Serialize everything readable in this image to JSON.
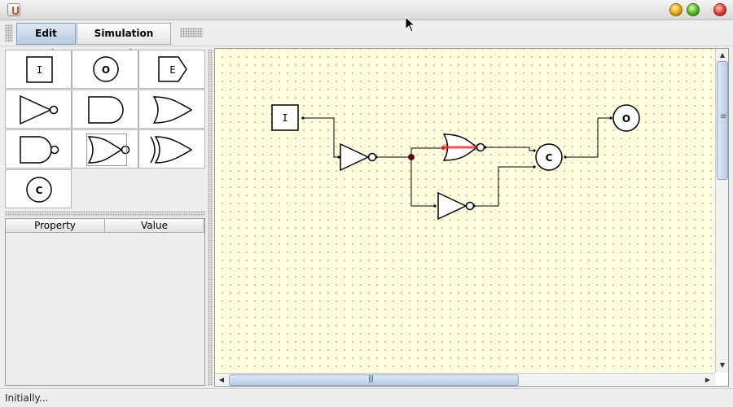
{
  "window": {
    "controls": [
      "minimize",
      "maximize",
      "close"
    ]
  },
  "toolbar": {
    "edit_mode_label": "Edit Mode",
    "simulation_mode_label": "Simulation Mode",
    "active_mode": "Edit Mode"
  },
  "palette": {
    "items": [
      {
        "name": "input",
        "label": "I",
        "icon": "input-box-icon"
      },
      {
        "name": "output",
        "label": "O",
        "icon": "output-circle-icon"
      },
      {
        "name": "edge-connector",
        "label": "E",
        "icon": "edge-pentagon-icon"
      },
      {
        "name": "not-gate",
        "label": "",
        "icon": "not-gate-icon"
      },
      {
        "name": "and-gate",
        "label": "",
        "icon": "and-gate-icon"
      },
      {
        "name": "or-gate",
        "label": "",
        "icon": "or-gate-icon"
      },
      {
        "name": "nand-gate",
        "label": "",
        "icon": "nand-gate-icon"
      },
      {
        "name": "nor-gate",
        "label": "",
        "icon": "nor-gate-icon",
        "selected": true
      },
      {
        "name": "xor-gate",
        "label": "",
        "icon": "xor-gate-icon"
      },
      {
        "name": "c-element",
        "label": "C",
        "icon": "c-element-icon"
      }
    ]
  },
  "properties": {
    "col_property": "Property",
    "col_value": "Value"
  },
  "circuit": {
    "input_label": "I",
    "output_label": "O",
    "c_element_label": "C",
    "highlight_color": "#ff2020",
    "junction_color": "#6b0000"
  },
  "status": {
    "text": "Initially..."
  },
  "colors": {
    "canvas_bg": "#ffffe0",
    "mode_active": "#b9cbe0"
  }
}
